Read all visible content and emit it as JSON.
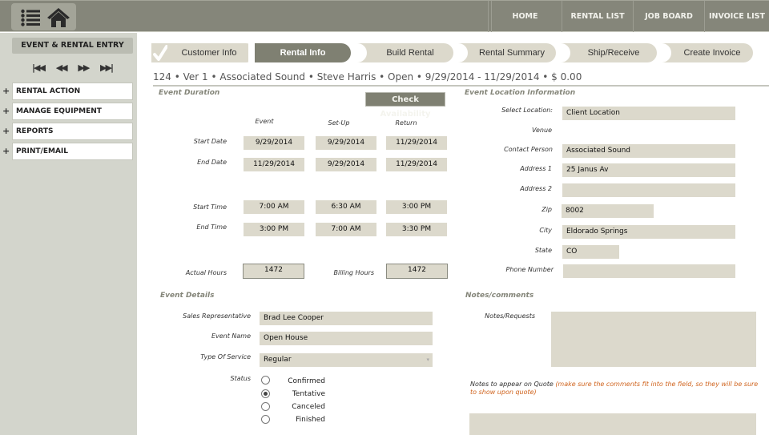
{
  "topbar": {
    "icons": [
      "list-icon",
      "home-icon"
    ],
    "nav": [
      {
        "label": "HOME"
      },
      {
        "label": "RENTAL LIST"
      },
      {
        "label": "JOB BOARD"
      },
      {
        "label": "INVOICE LIST"
      }
    ]
  },
  "sidebar": {
    "title": "EVENT & RENTAL ENTRY",
    "media_controls": [
      "⏮",
      "⏪",
      "⏩",
      "⏭"
    ],
    "items": [
      {
        "plus": "+",
        "label": "RENTAL ACTION"
      },
      {
        "plus": "+",
        "label": "MANAGE EQUIPMENT"
      },
      {
        "plus": "+",
        "label": "REPORTS"
      },
      {
        "plus": "+",
        "label": "PRINT/EMAIL"
      }
    ]
  },
  "steps": [
    {
      "label": "Customer Info",
      "state": "completed"
    },
    {
      "label": "Rental Info",
      "state": "active"
    },
    {
      "label": "Build Rental",
      "state": "pending"
    },
    {
      "label": "Rental Summary",
      "state": "pending"
    },
    {
      "label": "Ship/Receive",
      "state": "pending"
    },
    {
      "label": "Create Invoice",
      "state": "pending"
    }
  ],
  "infoline": "124 • Ver 1 • Associated Sound • Steve Harris • Open • 9/29/2014 - 11/29/2014 • $ 0.00",
  "event_duration": {
    "title": "Event Duration",
    "check_availability": "Check Availability",
    "columns": [
      "Event",
      "Set-Up",
      "Return"
    ],
    "rows": [
      {
        "label": "Start Date",
        "values": [
          "9/29/2014",
          "9/29/2014",
          "11/29/2014"
        ]
      },
      {
        "label": "End Date",
        "values": [
          "11/29/2014",
          "9/29/2014",
          "11/29/2014"
        ]
      },
      {
        "label": "Start Time",
        "values": [
          "7:00 AM",
          "6:30 AM",
          "3:00 PM"
        ]
      },
      {
        "label": "End Time",
        "values": [
          "3:00 PM",
          "7:00 AM",
          "3:30 PM"
        ]
      }
    ],
    "actual_hours_label": "Actual Hours",
    "actual_hours": "1472",
    "billing_hours_label": "Billing Hours",
    "billing_hours": "1472"
  },
  "location": {
    "title": "Event Location Information",
    "fields": [
      {
        "label": "Select Location:",
        "value": "Client Location"
      },
      {
        "label": "Venue",
        "value": ""
      },
      {
        "label": "Contact Person",
        "value": "Associated Sound"
      },
      {
        "label": "Address 1",
        "value": "25 Janus Av"
      },
      {
        "label": "Address 2",
        "value": ""
      },
      {
        "label": "Zip",
        "value": "8002"
      },
      {
        "label": "City",
        "value": "Eldorado Springs"
      },
      {
        "label": "State",
        "value": "CO"
      },
      {
        "label": "Phone Number",
        "value": ""
      }
    ]
  },
  "event_details": {
    "title": "Event Details",
    "sales_rep_label": "Sales Representative",
    "sales_rep": "Brad Lee Cooper",
    "event_name_label": "Event Name",
    "event_name": "Open House",
    "service_label": "Type Of Service",
    "service": "Regular",
    "status_label": "Status",
    "status_options": [
      {
        "label": "Confirmed",
        "selected": false
      },
      {
        "label": "Tentative",
        "selected": true
      },
      {
        "label": "Canceled",
        "selected": false
      },
      {
        "label": "Finished",
        "selected": false
      }
    ]
  },
  "notes": {
    "title": "Notes/comments",
    "requests_label": "Notes/Requests",
    "requests_value": "",
    "quote_label": "Notes to appear on Quote",
    "quote_hint": "(make sure the comments fit into the field, so they will be sure to show upon quote)",
    "quote_value": ""
  },
  "colors": {
    "topbar": "#85867a",
    "accent": "#7f8072",
    "field_bg": "#dcd9cc",
    "sidebar_bg": "#d3d5cc",
    "hint_orange": "#d0641e"
  }
}
